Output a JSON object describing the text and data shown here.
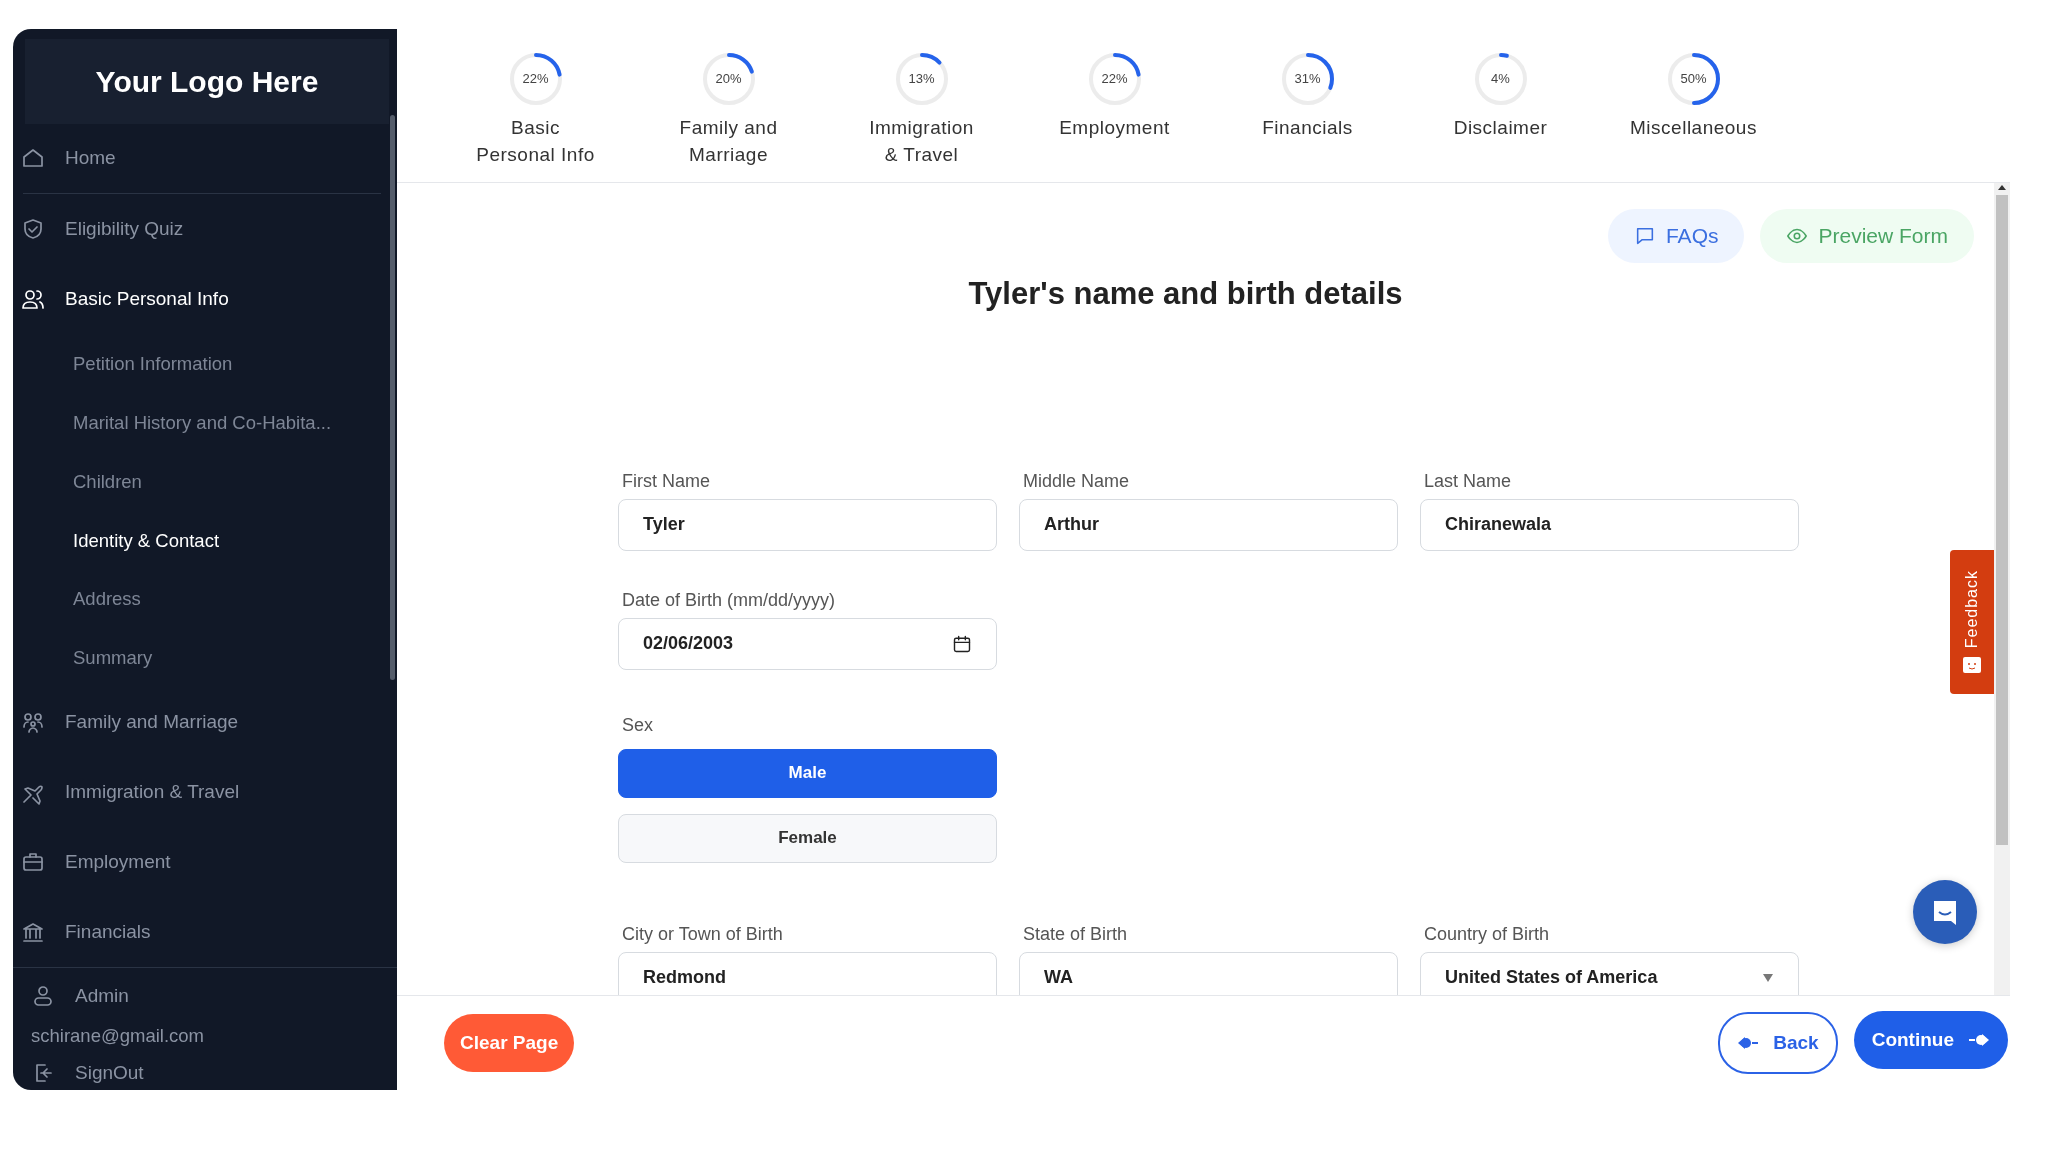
{
  "sidebar": {
    "logo": "Your Logo Here",
    "items": [
      {
        "label": "Home",
        "selected": false
      },
      {
        "label": "Eligibility Quiz",
        "selected": false
      },
      {
        "label": "Basic Personal Info",
        "selected": true,
        "expanded": true,
        "children": [
          {
            "label": "Petition Information",
            "selected": false
          },
          {
            "label": "Marital History and Co-Habita...",
            "selected": false
          },
          {
            "label": "Children",
            "selected": false
          },
          {
            "label": "Identity & Contact",
            "selected": true
          },
          {
            "label": "Address",
            "selected": false
          },
          {
            "label": "Summary",
            "selected": false
          }
        ]
      },
      {
        "label": "Family and Marriage",
        "selected": false
      },
      {
        "label": "Immigration & Travel",
        "selected": false
      },
      {
        "label": "Employment",
        "selected": false
      },
      {
        "label": "Financials",
        "selected": false
      }
    ],
    "user": {
      "name": "Admin",
      "email": "schirane@gmail.com"
    },
    "signout": "SignOut"
  },
  "progress": [
    {
      "percent": "22%",
      "level": 0.22,
      "label": "Basic\nPersonal Info"
    },
    {
      "percent": "20%",
      "level": 0.2,
      "label": "Family and\nMarriage"
    },
    {
      "percent": "13%",
      "level": 0.13,
      "label": "Immigration\n& Travel"
    },
    {
      "percent": "22%",
      "level": 0.22,
      "label": "Employment"
    },
    {
      "percent": "31%",
      "level": 0.31,
      "label": "Financials"
    },
    {
      "percent": "4%",
      "level": 0.04,
      "label": "Disclaimer"
    },
    {
      "percent": "50%",
      "level": 0.5,
      "label": "Miscellaneous"
    }
  ],
  "actions": {
    "faqs": "FAQs",
    "preview": "Preview Form"
  },
  "title": "Tyler's name and birth details",
  "rows": [
    [
      {
        "kind": "text",
        "label": "First Name",
        "value": "Tyler"
      },
      {
        "kind": "text",
        "label": "Middle Name",
        "value": "Arthur"
      },
      {
        "kind": "text",
        "label": "Last Name",
        "value": "Chiranewala"
      }
    ],
    [
      {
        "kind": "date",
        "label": "Date of Birth (mm/dd/yyyy)",
        "value": "02/06/2003"
      }
    ],
    [
      {
        "kind": "choice",
        "label": "Sex",
        "options": [
          {
            "label": "Male",
            "selected": true
          },
          {
            "label": "Female",
            "selected": false
          }
        ]
      }
    ],
    [
      {
        "kind": "text",
        "label": "City or Town of Birth",
        "value": "Redmond"
      },
      {
        "kind": "text",
        "label": "State of Birth",
        "value": "WA"
      },
      {
        "kind": "select",
        "label": "Country of Birth",
        "value": "United States of America"
      }
    ]
  ],
  "feedback": "Feedback",
  "footer": {
    "clear": "Clear Page",
    "back": "Back",
    "continue": "Continue"
  }
}
